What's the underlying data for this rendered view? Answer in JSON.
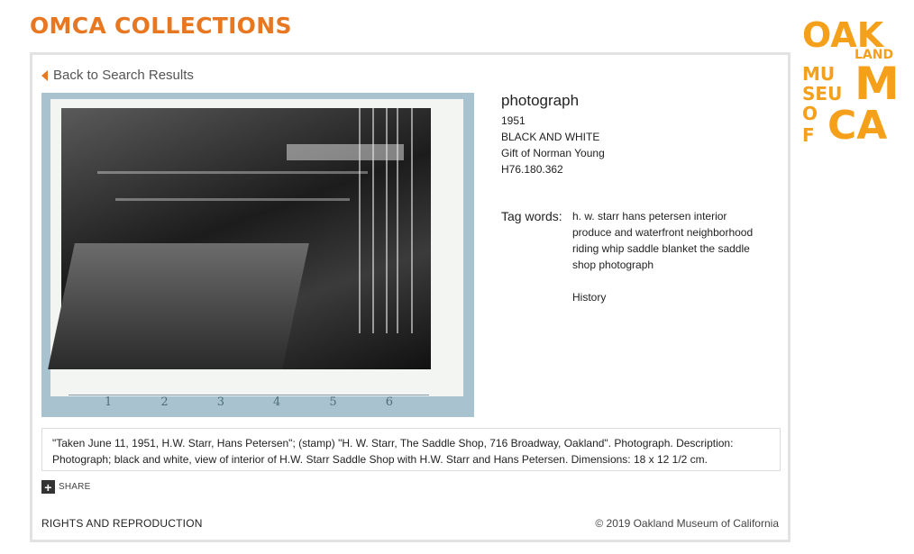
{
  "header": {
    "site_title": "OMCA COLLECTIONS",
    "logo": {
      "row1": "OAK",
      "row1b": "LAND",
      "row2": "MU",
      "row3": "SEU",
      "row3b": "M",
      "row4": "O",
      "row4b": "F",
      "row4c": "CA",
      "color": "#f5a01a"
    },
    "accent_color": "#e87722"
  },
  "nav": {
    "back_label": "Back to Search Results"
  },
  "object": {
    "title": "photograph",
    "year": "1951",
    "color_type": "BLACK AND WHITE",
    "credit": "Gift of Norman Young",
    "accession": "H76.180.362"
  },
  "tags": {
    "label": "Tag words:",
    "words": "h. w. starr hans petersen interior produce and waterfront neighborhood riding whip saddle blanket the saddle shop photograph",
    "history_link": "History"
  },
  "ruler": [
    "1",
    "2",
    "3",
    "4",
    "5",
    "6"
  ],
  "description": "\"Taken June 11, 1951, H.W. Starr, Hans Petersen\"; (stamp) \"H. W. Starr, The Saddle Shop, 716 Broadway, Oakland\". Photograph. Description: Photograph; black and white, view of interior of H.W. Starr Saddle Shop with H.W. Starr and Hans Petersen. Dimensions: 18 x 12 1/2 cm.",
  "share": {
    "icon": "plus-icon",
    "label": "SHARE"
  },
  "footer": {
    "rights_label": "RIGHTS AND REPRODUCTION",
    "copyright": "© 2019 Oakland Museum of California"
  }
}
